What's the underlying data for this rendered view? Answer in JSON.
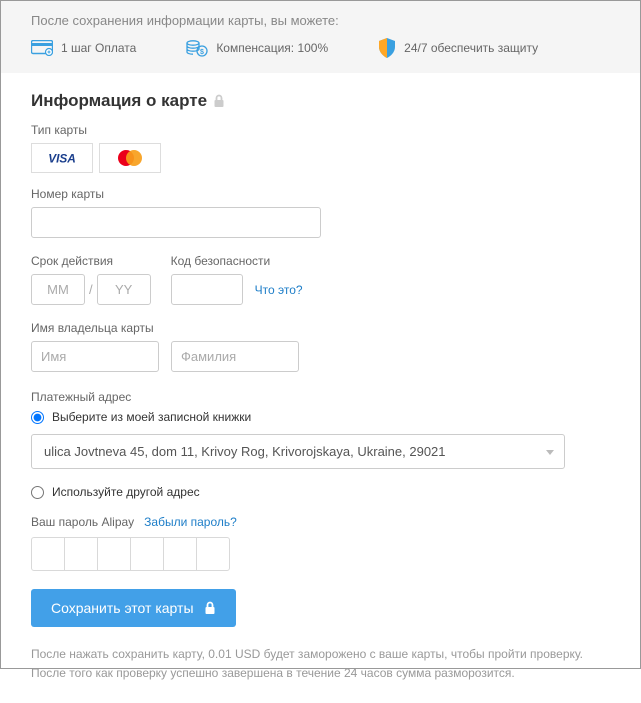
{
  "topbar": {
    "title": "После сохранения информации карты, вы можете:",
    "item1": "1 шаг Оплата",
    "item2": "Компенсация: 100%",
    "item3": "24/7 обеспечить защиту"
  },
  "section": {
    "title": "Информация о карте"
  },
  "labels": {
    "cardType": "Тип карты",
    "cardNumber": "Номер карты",
    "expiry": "Срок действия",
    "cvv": "Код безопасности",
    "cvvHelp": "Что это?",
    "holder": "Имя владельца карты",
    "billing": "Платежный адрес",
    "radioSaved": "Выберите из моей записной книжки",
    "radioOther": "Используйте другой адрес",
    "alipayLabel": "Ваш пароль Alipay",
    "forgot": "Забыли пароль?"
  },
  "placeholders": {
    "mm": "ММ",
    "yy": "YY",
    "firstName": "Имя",
    "lastName": "Фамилия"
  },
  "address": {
    "selected": "ulica Jovtneva 45, dom 11, Krivoy Rog, Krivorojskaya, Ukraine, 29021"
  },
  "button": {
    "save": "Сохранить этот карты"
  },
  "note": "После нажать сохранить карту, 0.01 USD будет заморожено с ваше карты, чтобы пройти проверку. После того как проверку успешно завершена в течение 24 часов сумма разморозится.",
  "cardBrands": {
    "visa": "VISA",
    "mastercard": "mastercard"
  },
  "colors": {
    "accent": "#42a0e8",
    "link": "#1e7ec8"
  }
}
